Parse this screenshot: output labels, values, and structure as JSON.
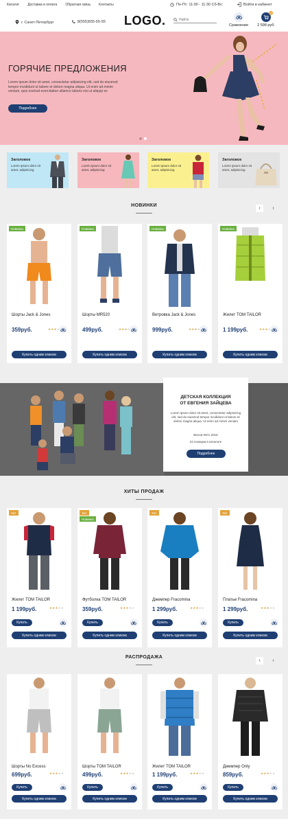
{
  "header": {
    "top_links": [
      "Каталог",
      "Доставка и оплата",
      "Обратная связь",
      "Контакты"
    ],
    "hours": "Пн-Пт: 11:00 - 11:30 Сб-Вс:",
    "login": "Войти в кабинет",
    "city": "г. Санкт-Петербург",
    "phone": "8(555)555-55-55",
    "logo": "LOGO.",
    "search_placeholder": "Найти",
    "compare_label": "Сравнение",
    "cart_total": "2 598 руб.",
    "cart_count": "0"
  },
  "hero": {
    "title": "ГОРЯЧИЕ ПРЕДЛОЖЕНИЯ",
    "text": "Lorem ipsum dolor sit amet, consectetur adipisicing elit, sed do eiusmod tempor incididunt ut labore et dolore magna aliqua. Ut enim ad minim veniam, quis nostrud exercitation ullamco laboris nisi ut aliquip ex",
    "button": "Подробнее",
    "slides": 2,
    "active_slide": 1
  },
  "promos": [
    {
      "title": "Заголовок",
      "text": "Lorem ipsum dolor sit amet, adipisicing",
      "color": "#bfe7f6"
    },
    {
      "title": "Заголовок",
      "text": "Lorem ipsum dolor sit amet, adipisicing",
      "color": "#f6b7bd"
    },
    {
      "title": "Заголовок",
      "text": "Lorem ipsum dolor sit amet, adipisicing",
      "color": "#fbf08f"
    },
    {
      "title": "Заголовок",
      "text": "Lorem ipsum dolor sit amet, adipisicing",
      "color": "#e3e3e3"
    }
  ],
  "new_section": {
    "title": "НОВИНКИ",
    "products": [
      {
        "badge": "Новинка",
        "name": "Шорты Jack & Jones",
        "price": "359руб.",
        "rating": 3,
        "buy_one": "Купить одним кликом",
        "item": "orange-shorts"
      },
      {
        "badge": "Новинка",
        "name": "Шорты MR520",
        "price": "499руб.",
        "rating": 3,
        "buy_one": "Купить одним кликом",
        "item": "denim-shorts"
      },
      {
        "badge": "Новинка",
        "name": "Ветровка Jack & Jones",
        "price": "999руб.",
        "rating": 3,
        "buy_one": "Купить одним кликом",
        "item": "navy-jacket"
      },
      {
        "badge": "Новинка",
        "name": "Жилет TOM TAILOR",
        "price": "1 199руб.",
        "rating": 3,
        "buy_one": "Купить одним кликом",
        "item": "green-vest"
      }
    ]
  },
  "kids": {
    "title_line1": "ДЕТСКАЯ КОЛЛЕКЦИЯ",
    "title_line2": "ОТ ЕВГЕНИЯ ЗАЙЦЕВА",
    "text": "Lorem ipsum dolor sit amet, consectetur adipisicing elit, sed do eiusmod tempor incididunt ut labore et dolore magna aliqua. Ut enim ad minim veniam",
    "season": "Весна-Лето 2016",
    "count": "24 позиции в каталоге",
    "button": "Подробнее"
  },
  "hits_section": {
    "title": "ХИТЫ ПРОДАЖ",
    "products": [
      {
        "badges": [
          "Хит"
        ],
        "name": "Жилет TOM TAILOR",
        "price": "1 199руб.",
        "rating": 3,
        "buy": "Купить",
        "buy_one": "Купить одним кликом",
        "item": "navy-vest"
      },
      {
        "badges": [
          "Хит",
          "Новинка"
        ],
        "name": "Футболка TOM TAILOR",
        "price": "359руб.",
        "rating": 3,
        "buy": "Купить",
        "buy_one": "Купить одним кликом",
        "item": "maroon-top"
      },
      {
        "badges": [
          "Хит"
        ],
        "name": "Джемпер Fracomina",
        "price": "1 299руб.",
        "rating": 3,
        "buy": "Купить",
        "buy_one": "Купить одним кликом",
        "item": "blue-jumper"
      },
      {
        "badges": [
          "Хит"
        ],
        "name": "Платье Fracomina",
        "price": "1 299руб.",
        "rating": 3,
        "buy": "Купить",
        "buy_one": "Купить одним кликом",
        "item": "navy-dress"
      }
    ]
  },
  "sale_section": {
    "title": "РАСПРОДАЖА",
    "products": [
      {
        "name": "Шорты No Excess",
        "price": "699руб.",
        "rating": 3,
        "buy": "Купить",
        "buy_one": "Купить одним кликом",
        "item": "grey-shorts"
      },
      {
        "name": "Шорты TOM TAILOR",
        "price": "499руб.",
        "rating": 3,
        "buy": "Купить",
        "buy_one": "Купить одним кликом",
        "item": "green-shorts"
      },
      {
        "name": "Жилет TOM TAILOR",
        "price": "1 199руб.",
        "rating": 3,
        "buy": "Купить",
        "buy_one": "Купить одним кликом",
        "item": "blue-vest"
      },
      {
        "name": "Джемпер Only",
        "price": "859руб.",
        "rating": 3,
        "buy": "Купить",
        "buy_one": "Купить одним кликом",
        "item": "black-jumper"
      }
    ]
  },
  "colors": {
    "accent": "#1f3f73",
    "hero_bg": "#f6b8bf",
    "badge_new": "#6ab041",
    "badge_hit": "#e3a33b",
    "star": "#d9a441"
  }
}
